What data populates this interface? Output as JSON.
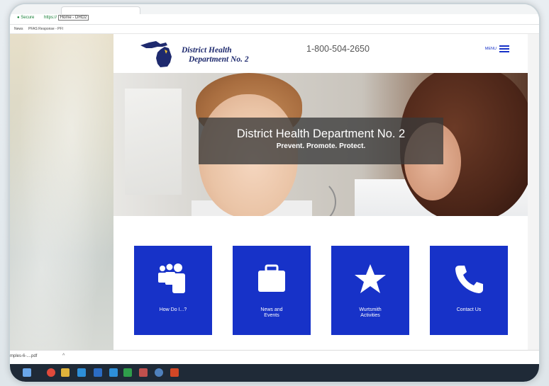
{
  "browser": {
    "secure_label": "Secure",
    "url_prefix": "https://",
    "tab_title": "Home - DHD2",
    "bookmarks": [
      "News",
      "PFAS Response - PFI"
    ]
  },
  "site": {
    "logo_line1": "District Health",
    "logo_line2": "Department No. 2",
    "phone": "1-800-504-2650",
    "menu_label": "MENU",
    "hero_title": "District Health Department No. 2",
    "hero_tagline": "Prevent. Promote. Protect.",
    "cards": [
      {
        "label_line1": "How Do I...?",
        "label_line2": "",
        "icon": "people-icon"
      },
      {
        "label_line1": "News and",
        "label_line2": "Events",
        "icon": "briefcase-icon"
      },
      {
        "label_line1": "Wurtsmith",
        "label_line2": "Activities",
        "icon": "star-icon"
      },
      {
        "label_line1": "Contact Us",
        "label_line2": "",
        "icon": "phone-icon"
      }
    ],
    "accent_color": "#1732c8"
  },
  "downloads": {
    "file_label": "mples-6-....pdf",
    "caret": "^"
  }
}
